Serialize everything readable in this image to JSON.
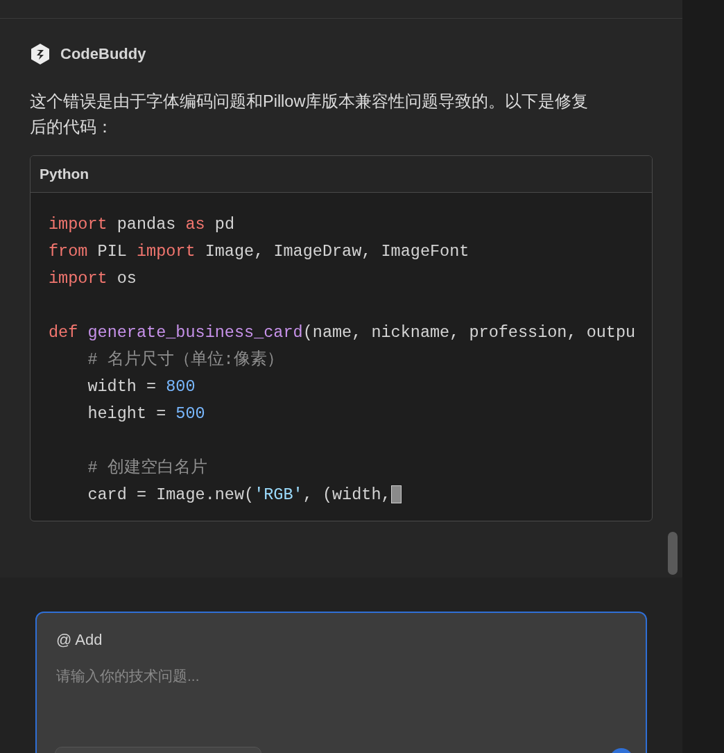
{
  "assistant": {
    "name": "CodeBuddy"
  },
  "message": "这个错误是由于字体编码问题和Pillow库版本兼容性问题导致的。以下是修复后的代码：",
  "code_block": {
    "language": "Python",
    "lines": [
      {
        "kind": "code",
        "tokens": [
          {
            "kind": "keyword",
            "text": "import"
          },
          {
            "kind": "plain",
            "text": " pandas "
          },
          {
            "kind": "keyword",
            "text": "as"
          },
          {
            "kind": "plain",
            "text": " pd"
          }
        ]
      },
      {
        "kind": "code",
        "tokens": [
          {
            "kind": "keyword",
            "text": "from"
          },
          {
            "kind": "plain",
            "text": " PIL "
          },
          {
            "kind": "keyword",
            "text": "import"
          },
          {
            "kind": "plain",
            "text": " Image, ImageDraw, ImageFont"
          }
        ]
      },
      {
        "kind": "code",
        "tokens": [
          {
            "kind": "keyword",
            "text": "import"
          },
          {
            "kind": "plain",
            "text": " os"
          }
        ]
      },
      {
        "kind": "blank"
      },
      {
        "kind": "code",
        "tokens": [
          {
            "kind": "keyword",
            "text": "def "
          },
          {
            "kind": "function",
            "text": "generate_business_card"
          },
          {
            "kind": "plain",
            "text": "(name, nickname, profession, outpu"
          }
        ]
      },
      {
        "kind": "code",
        "tokens": [
          {
            "kind": "comment",
            "text": "    # 名片尺寸（单位:像素）"
          }
        ]
      },
      {
        "kind": "code",
        "tokens": [
          {
            "kind": "plain",
            "text": "    width = "
          },
          {
            "kind": "number",
            "text": "800"
          }
        ]
      },
      {
        "kind": "code",
        "tokens": [
          {
            "kind": "plain",
            "text": "    height = "
          },
          {
            "kind": "number",
            "text": "500"
          }
        ]
      },
      {
        "kind": "blank"
      },
      {
        "kind": "code",
        "tokens": [
          {
            "kind": "comment",
            "text": "    # 创建空白名片"
          }
        ]
      },
      {
        "kind": "code",
        "tokens": [
          {
            "kind": "plain",
            "text": "    card = Image.new("
          },
          {
            "kind": "string",
            "text": "'RGB'"
          },
          {
            "kind": "plain",
            "text": ", (width,"
          }
        ]
      }
    ]
  },
  "input": {
    "mention": "@ Add",
    "placeholder": "请输入你的技术问题..."
  }
}
